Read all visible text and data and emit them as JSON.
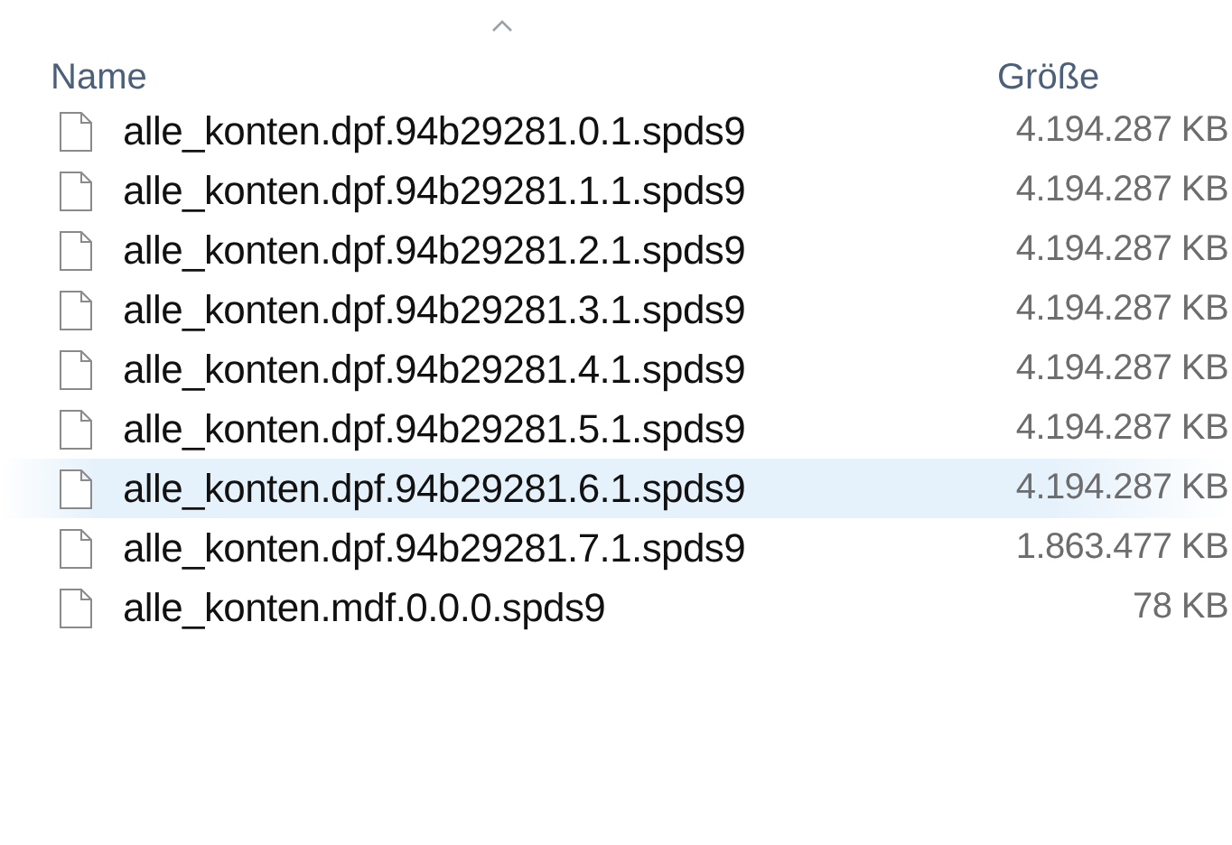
{
  "columns": [
    {
      "label": "Name",
      "sorted": true
    },
    {
      "label": "Größe",
      "sorted": false
    }
  ],
  "files": [
    {
      "name": "alle_konten.dpf.94b29281.0.1.spds9",
      "size": "4.194.287 KB",
      "selected": false
    },
    {
      "name": "alle_konten.dpf.94b29281.1.1.spds9",
      "size": "4.194.287 KB",
      "selected": false
    },
    {
      "name": "alle_konten.dpf.94b29281.2.1.spds9",
      "size": "4.194.287 KB",
      "selected": false
    },
    {
      "name": "alle_konten.dpf.94b29281.3.1.spds9",
      "size": "4.194.287 KB",
      "selected": false
    },
    {
      "name": "alle_konten.dpf.94b29281.4.1.spds9",
      "size": "4.194.287 KB",
      "selected": false
    },
    {
      "name": "alle_konten.dpf.94b29281.5.1.spds9",
      "size": "4.194.287 KB",
      "selected": false
    },
    {
      "name": "alle_konten.dpf.94b29281.6.1.spds9",
      "size": "4.194.287 KB",
      "selected": true
    },
    {
      "name": "alle_konten.dpf.94b29281.7.1.spds9",
      "size": "1.863.477 KB",
      "selected": false
    },
    {
      "name": "alle_konten.mdf.0.0.0.spds9",
      "size": "78 KB",
      "selected": false
    }
  ]
}
